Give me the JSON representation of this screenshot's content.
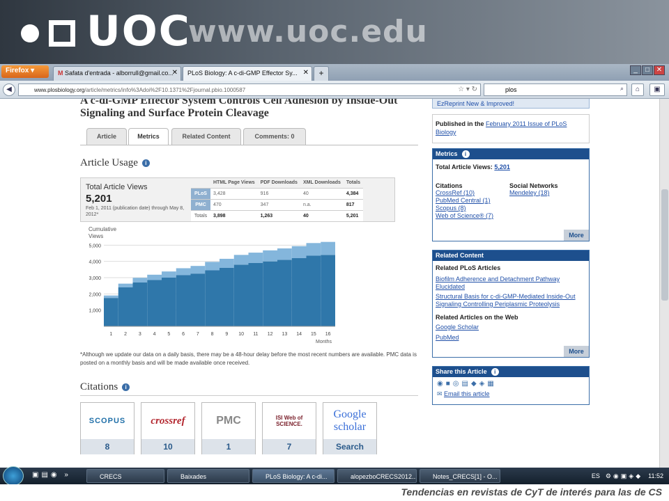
{
  "banner": {
    "logo": "UOC",
    "url": "www.uoc.edu"
  },
  "browser": {
    "firefox_label": "Firefox",
    "tabs": [
      {
        "label": "Safata d'entrada - alborrull@gmail.co..."
      },
      {
        "label": "PLoS Biology: A c-di-GMP Effector Sy..."
      }
    ],
    "new_tab": "+",
    "url_host": "www.plosbiology.org",
    "url_path": "/article/metrics/info%3Adoi%2F10.1371%2Fjournal.pbio.1000587",
    "search_value": "plos"
  },
  "article": {
    "title": "A c-di-GMP Effector System Controls Cell Adhesion by Inside-Out Signaling and Surface Protein Cleavage",
    "tabs": [
      "Article",
      "Metrics",
      "Related Content",
      "Comments: 0"
    ],
    "usage_heading": "Article Usage",
    "total_views_label": "Total Article Views",
    "total_views": "5,201",
    "date_range": "Feb 1, 2011 (publication date) through May 8, 2012*",
    "table": {
      "headers": [
        "",
        "HTML Page Views",
        "PDF Downloads",
        "XML Downloads",
        "Totals"
      ],
      "rows": [
        {
          "src": "PLoS",
          "html": "3,428",
          "pdf": "916",
          "xml": "40",
          "total": "4,384"
        },
        {
          "src": "PMC",
          "html": "470",
          "pdf": "347",
          "xml": "n.a.",
          "total": "817"
        },
        {
          "src": "Totals",
          "html": "3,898",
          "pdf": "1,263",
          "xml": "40",
          "total": "5,201"
        }
      ]
    },
    "footnote": "*Although we update our data on a daily basis, there may be a 48-hour delay before the most recent numbers are available. PMC data is posted on a monthly basis and will be made available once received.",
    "citations_heading": "Citations",
    "citations": [
      {
        "name": "SCOPUS",
        "count": "8"
      },
      {
        "name": "crossref",
        "count": "10"
      },
      {
        "name": "PMC",
        "count": "1"
      },
      {
        "name": "ISI Web of SCIENCE.",
        "count": "7"
      },
      {
        "name": "Google scholar",
        "count": "Search"
      }
    ]
  },
  "chart_data": {
    "type": "bar",
    "ylabel": "Cumulative Views",
    "xlabel": "Months",
    "categories": [
      "1",
      "2",
      "3",
      "4",
      "5",
      "6",
      "7",
      "8",
      "9",
      "10",
      "11",
      "12",
      "13",
      "14",
      "15",
      "16"
    ],
    "ylim": [
      0,
      6000
    ],
    "yticks": [
      "1,000",
      "2,000",
      "3,000",
      "4,000",
      "5,000"
    ],
    "series": [
      {
        "name": "PLoS",
        "values": [
          1750,
          2400,
          2700,
          2850,
          3000,
          3150,
          3250,
          3450,
          3600,
          3800,
          3900,
          4000,
          4100,
          4200,
          4350,
          4400
        ]
      },
      {
        "name": "PMC",
        "values": [
          150,
          230,
          290,
          330,
          380,
          430,
          470,
          520,
          560,
          600,
          640,
          680,
          700,
          740,
          780,
          800
        ]
      }
    ],
    "colors": {
      "PLoS": "#2f77aa",
      "PMC": "#84b6dc"
    }
  },
  "sidebar": {
    "ezreprint": "EzReprint New & Improved!",
    "published_prefix": "Published in the ",
    "published_link": "February 2011 Issue of PLoS Biology",
    "metrics": {
      "head": "Metrics",
      "total_label": "Total Article Views: ",
      "total": "5,201",
      "citations_label": "Citations",
      "citations": [
        "CrossRef (10)",
        "PubMed Central (1)",
        "Scopus (8)",
        "Web of Science® (7)"
      ],
      "social_label": "Social Networks",
      "social": [
        "Mendeley (18)"
      ],
      "more": "More"
    },
    "related": {
      "head": "Related Content",
      "plos_label": "Related PLoS Articles",
      "plos_links": [
        "Biofilm Adherence and Detachment Pathway Elucidated",
        "Structural Basis for c-di-GMP-Mediated Inside-Out Signaling Controlling Periplasmic Proteolysis"
      ],
      "web_label": "Related Articles on the Web",
      "web_links": [
        "Google Scholar",
        "PubMed"
      ],
      "more": "More"
    },
    "share": {
      "head": "Share this Article",
      "email": "Email this article"
    }
  },
  "taskbar": {
    "items": [
      "CRECS",
      "Baixades",
      "PLoS Biology: A c-di...",
      "alopezboCRECS2012...",
      "Notes_CRECS[1] - O..."
    ],
    "lang": "ES",
    "clock": "11:52"
  },
  "caption": "Tendencias en revistas de CyT de interés para las de CS"
}
